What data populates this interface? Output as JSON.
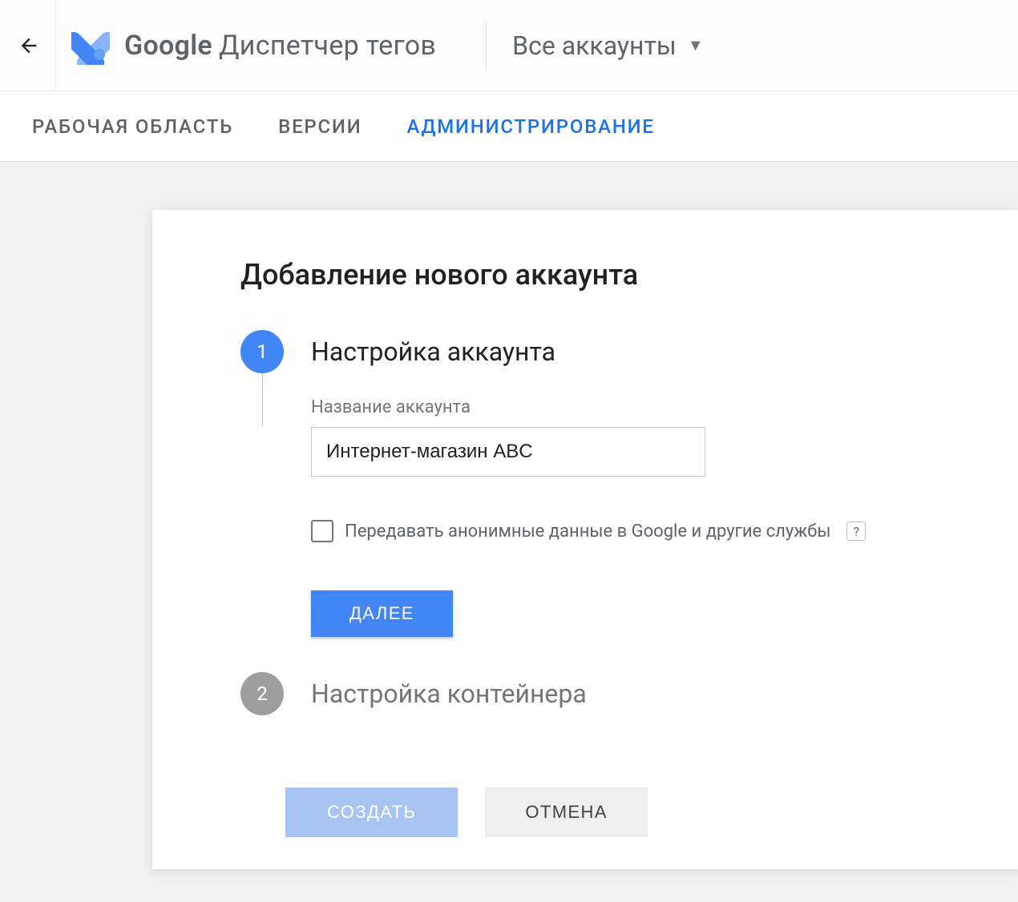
{
  "header": {
    "brand_google": "Google",
    "brand_product": "Диспетчер тегов",
    "account_picker": "Все аккаунты"
  },
  "tabs": {
    "workspace": "РАБОЧАЯ ОБЛАСТЬ",
    "versions": "ВЕРСИИ",
    "admin": "АДМИНИСТРИРОВАНИЕ"
  },
  "card": {
    "title": "Добавление нового аккаунта",
    "step1": {
      "num": "1",
      "title": "Настройка аккаунта",
      "field_label": "Название аккаунта",
      "field_value": "Интернет-магазин ABC",
      "checkbox_label": "Передавать анонимные данные в Google и другие службы",
      "help": "?",
      "next": "ДАЛЕЕ"
    },
    "step2": {
      "num": "2",
      "title": "Настройка контейнера"
    },
    "footer": {
      "create": "СОЗДАТЬ",
      "cancel": "ОТМЕНА"
    }
  }
}
